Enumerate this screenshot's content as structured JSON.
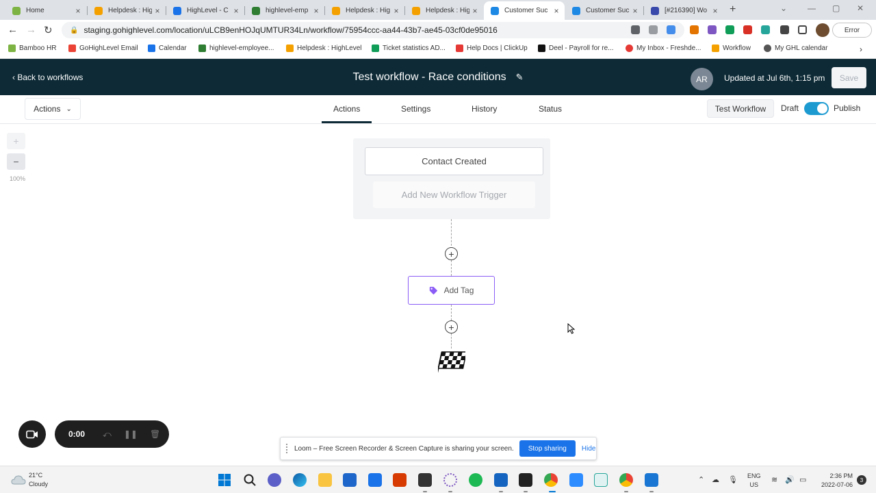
{
  "browser": {
    "tabs": [
      {
        "title": "Home",
        "color": "#7cb342",
        "active": false
      },
      {
        "title": "Helpdesk : Hig",
        "color": "#f4a100",
        "active": false
      },
      {
        "title": "HighLevel - C",
        "color": "#1a73e8",
        "active": false
      },
      {
        "title": "highlevel-emp",
        "color": "#2e7d32",
        "active": false
      },
      {
        "title": "Helpdesk : Hig",
        "color": "#f4a100",
        "active": false
      },
      {
        "title": "Helpdesk : Hig",
        "color": "#f4a100",
        "active": false
      },
      {
        "title": "Customer Suc",
        "color": "#1e88e5",
        "active": true
      },
      {
        "title": "Customer Suc",
        "color": "#1e88e5",
        "active": false
      },
      {
        "title": "[#216390] Wo",
        "color": "#3949ab",
        "active": false
      }
    ],
    "new_tab": "+",
    "url": "staging.gohighlevel.com/location/uLCB9enHOJqUMTUR34Ln/workflow/75954ccc-aa44-43b7-ae45-03cf0de95016",
    "error_label": "Error",
    "bookmarks": [
      {
        "label": "Bamboo HR",
        "color": "#7cb342"
      },
      {
        "label": "GoHighLevel Email",
        "color": "#ea4335"
      },
      {
        "label": "Calendar",
        "color": "#1a73e8"
      },
      {
        "label": "highlevel-employee...",
        "color": "#2e7d32"
      },
      {
        "label": "Helpdesk : HighLevel",
        "color": "#f4a100"
      },
      {
        "label": "Ticket statistics AD...",
        "color": "#0f9d58"
      },
      {
        "label": "Help Docs | ClickUp",
        "color": "#e53935"
      },
      {
        "label": "Deel - Payroll for re...",
        "color": "#111111"
      },
      {
        "label": "My Inbox - Freshde...",
        "color": "#e53935"
      },
      {
        "label": "Workflow",
        "color": "#f4a100"
      },
      {
        "label": "My GHL calendar",
        "color": "#555555"
      }
    ]
  },
  "header": {
    "back_label": "Back to workflows",
    "title": "Test workflow - Race conditions",
    "avatar_initials": "AR",
    "updated_text": "Updated at Jul 6th, 1:15 pm",
    "save_label": "Save"
  },
  "tabbar": {
    "actions_dropdown": "Actions",
    "tabs": [
      "Actions",
      "Settings",
      "History",
      "Status"
    ],
    "test_workflow_label": "Test Workflow",
    "draft_label": "Draft",
    "publish_label": "Publish",
    "publish_toggle_on": true
  },
  "canvas": {
    "zoom_in": "+",
    "zoom_out": "−",
    "zoom_level": "100%",
    "trigger_contact_created": "Contact Created",
    "trigger_add_new": "Add New Workflow Trigger",
    "action_add_tag": "Add Tag",
    "accent_color": "#8b5cf6"
  },
  "loom": {
    "timer": "0:00",
    "share_message": "Loom – Free Screen Recorder & Screen Capture is sharing your screen.",
    "stop_sharing": "Stop sharing",
    "hide": "Hide"
  },
  "taskbar": {
    "temperature": "21°C",
    "condition": "Cloudy",
    "lang_line1": "ENG",
    "lang_line2": "US",
    "time": "2:36 PM",
    "date": "2022-07-06",
    "notification_count": "3"
  }
}
